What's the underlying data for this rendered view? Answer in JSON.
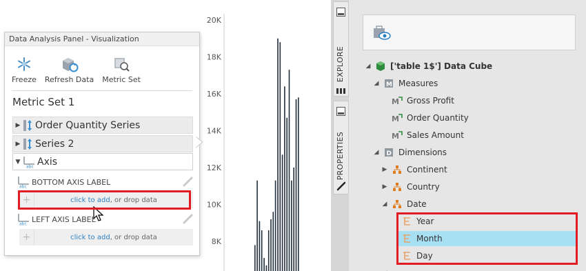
{
  "chart": {
    "y_ticks": [
      "20K",
      "18K",
      "16K",
      "14K",
      "12K",
      "10K",
      "8K"
    ]
  },
  "chart_data": {
    "type": "bar",
    "title": "",
    "xlabel": "",
    "ylabel": "",
    "ylim": [
      6500,
      20000
    ],
    "y_ticks": [
      8000,
      10000,
      12000,
      14000,
      16000,
      18000,
      20000
    ],
    "grid": false,
    "series": [
      {
        "values": [
          7800,
          11300,
          9100,
          8600,
          7100,
          6700,
          8600,
          9200,
          9600,
          11300,
          19000,
          18800,
          12700,
          16400,
          14700,
          17300,
          11300,
          12000,
          15700,
          15800
        ]
      }
    ]
  },
  "panel": {
    "title": "Data Analysis Panel - Visualization",
    "toolbar": [
      {
        "label": "Freeze",
        "icon": "snowflake-icon"
      },
      {
        "label": "Refresh Data",
        "icon": "refresh-data-icon"
      },
      {
        "label": "Metric Set",
        "icon": "metric-set-icon"
      }
    ],
    "metric_set_title": "Metric Set 1",
    "series": [
      {
        "label": "Order Quantity Series"
      },
      {
        "label": "Series 2"
      }
    ],
    "axis_label": "Axis",
    "bottom_axis_label": "BOTTOM AXIS LABEL",
    "left_axis_label": "LEFT AXIS LABEL",
    "drop_link": "click to add",
    "drop_rest": ", or drop data",
    "abc_badge": "abc"
  },
  "side_tabs": {
    "explore": "EXPLORE",
    "properties": "PROPERTIES"
  },
  "tree": {
    "cube": "['table 1$'] Data Cube",
    "measures": "Measures",
    "measure_items": [
      "Gross Profit",
      "Order Quantity",
      "Sales Amount"
    ],
    "dimensions": "Dimensions",
    "dimension_items": [
      "Continent",
      "Country",
      "Date"
    ],
    "date_items": [
      "Year",
      "Month",
      "Day"
    ]
  },
  "colors": {
    "bar": "#1f2d3d",
    "highlight_border": "#e31b23",
    "selected_row": "#a7dff3",
    "link": "#2a7fc1",
    "hierarchy_icon": "#e07b1f"
  }
}
